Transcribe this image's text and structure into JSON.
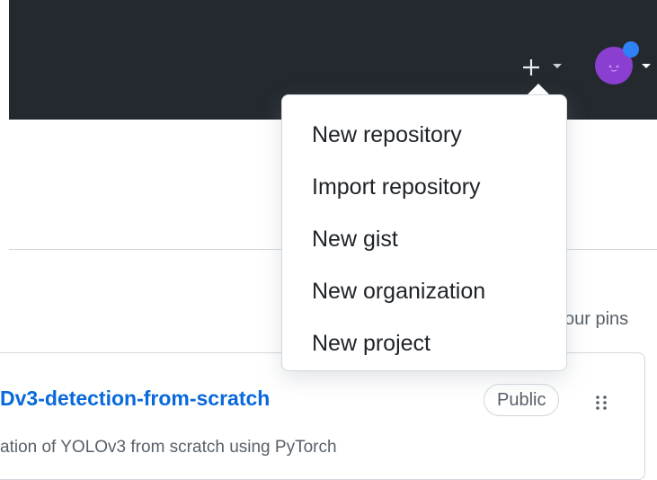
{
  "header": {
    "plus_icon": "plus-icon",
    "caret_icon": "caret-down-icon",
    "avatar_color": "#8a3fd1",
    "avatar_badge_color": "#2f81f7"
  },
  "create_menu": {
    "items": [
      {
        "label": "New repository"
      },
      {
        "label": "Import repository"
      },
      {
        "label": "New gist"
      },
      {
        "label": "New organization"
      },
      {
        "label": "New project"
      }
    ]
  },
  "pins": {
    "customize_text": "our pins"
  },
  "repo_card": {
    "title": "Dv3-detection-from-scratch",
    "visibility": "Public",
    "description": "ation of YOLOv3 from scratch using PyTorch",
    "grip_icon": "grabber-icon"
  },
  "colors": {
    "header_bg": "#24292f",
    "link": "#0969da",
    "border": "#d0d7de"
  }
}
